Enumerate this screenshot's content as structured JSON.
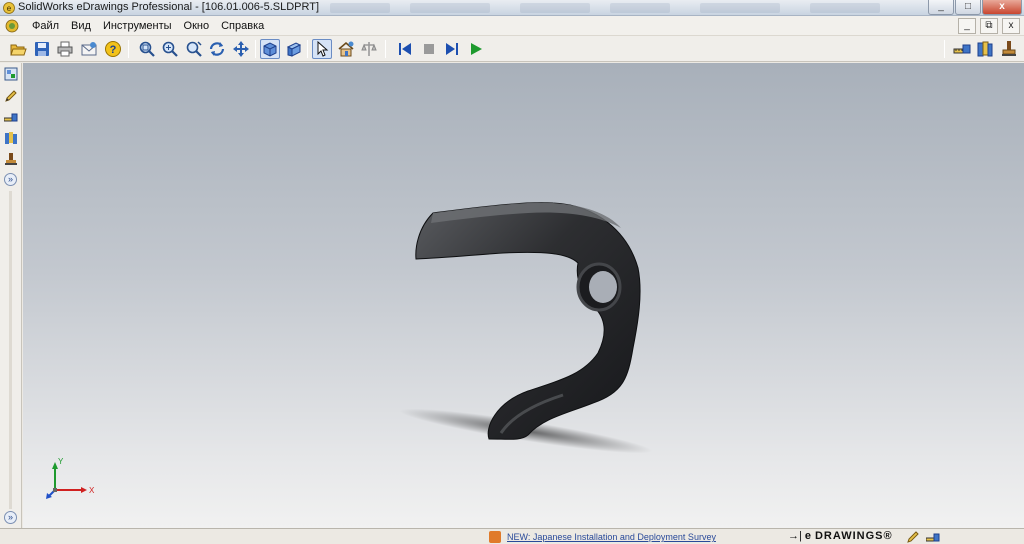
{
  "window": {
    "title": "SolidWorks eDrawings Professional - [106.01.006-5.SLDPRT]",
    "controls": [
      "_",
      "□",
      "x"
    ]
  },
  "menubar": {
    "items": [
      "Файл",
      "Вид",
      "Инструменты",
      "Окно",
      "Справка"
    ],
    "doc_controls": [
      "_",
      "⧉",
      "x"
    ]
  },
  "toolbar": {
    "buttons": [
      "open-icon",
      "save-icon",
      "print-icon",
      "send-icon",
      "help-icon",
      "zoom-fit-icon",
      "zoom-area-icon",
      "zoom-icon",
      "rotate-icon",
      "pan-icon",
      "shaded-view-icon",
      "perspective-view-icon",
      "select-icon",
      "home-view-icon",
      "section-icon",
      "first-frame-icon",
      "stop-icon",
      "next-frame-icon",
      "play-icon",
      "measure-icon",
      "markup-icon",
      "stamp-icon"
    ],
    "active": [
      "shaded-view-icon",
      "select-icon"
    ]
  },
  "leftbar": {
    "buttons": [
      "components-icon",
      "markup-pencil-icon",
      "measure-icon",
      "sheets-icon",
      "stamp-icon"
    ],
    "expand_symbol": "»"
  },
  "viewport": {
    "triad_labels": {
      "x": "X",
      "y": "Y"
    },
    "colors": {
      "part": "#2b2c2f",
      "background_top": "#a8b0ba",
      "background_bottom": "#f1f1f1"
    }
  },
  "statusbar": {
    "news_link": "NEW: Japanese Installation and Deployment Survey",
    "brand_arrow": "→|",
    "brand_logo": "e",
    "brand_text": "DRAWINGS®"
  }
}
